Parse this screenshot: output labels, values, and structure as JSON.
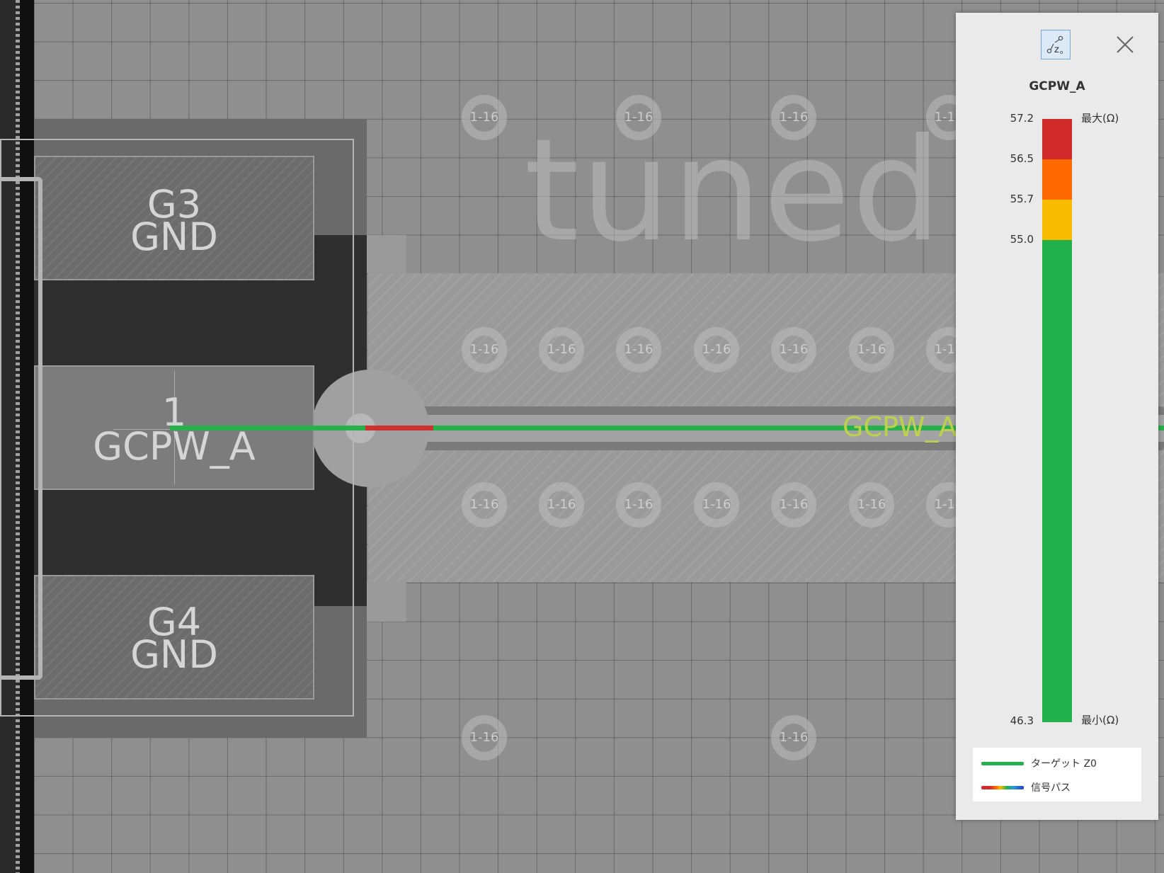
{
  "canvas": {
    "watermark": "tuned",
    "trace_net_label": "GCPW_A",
    "via_label": "1-16",
    "pads": [
      {
        "number": "G3",
        "net": "GND"
      },
      {
        "number": "1",
        "net": "GCPW_A"
      },
      {
        "number": "G4",
        "net": "GND"
      }
    ]
  },
  "panel": {
    "title": "GCPW_A",
    "icon": "impedance-zo-icon",
    "close": "close-icon",
    "max_label": "最大(Ω)",
    "min_label": "最小(Ω)",
    "ticks": [
      "57.2",
      "56.5",
      "55.7",
      "55.0",
      "46.3"
    ],
    "colors": {
      "red": "#d02a2a",
      "orange": "#ff6a00",
      "yellow": "#f8bb00",
      "green": "#22b14c"
    },
    "legend": [
      {
        "label": "ターゲット Z0",
        "swatch": "target-z0"
      },
      {
        "label": "信号パス",
        "swatch": "signal-path"
      }
    ]
  }
}
